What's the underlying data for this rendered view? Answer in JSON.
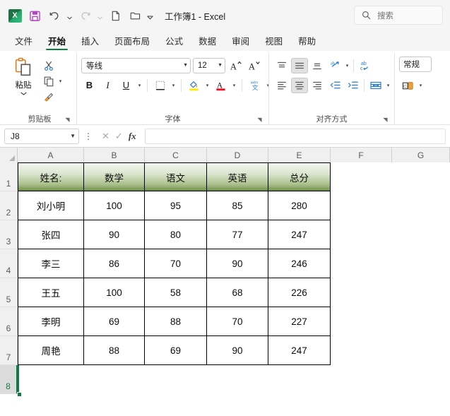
{
  "titlebar": {
    "document_title": "工作簿1  -  Excel",
    "app_logo": "excel-logo",
    "quick_access": [
      {
        "name": "save-icon",
        "glyph": "💾"
      },
      {
        "name": "undo-icon",
        "glyph": "↶"
      },
      {
        "name": "redo-icon",
        "glyph": "↷"
      },
      {
        "name": "new-file-icon",
        "glyph": "🗋"
      },
      {
        "name": "open-folder-icon",
        "glyph": "🗁"
      },
      {
        "name": "customize-qat-icon",
        "glyph": "ˇ"
      }
    ],
    "search": {
      "placeholder": "搜索",
      "icon": "search-icon"
    }
  },
  "ribbon_tabs": [
    {
      "label": "文件",
      "active": false
    },
    {
      "label": "开始",
      "active": true
    },
    {
      "label": "插入",
      "active": false
    },
    {
      "label": "页面布局",
      "active": false
    },
    {
      "label": "公式",
      "active": false
    },
    {
      "label": "数据",
      "active": false
    },
    {
      "label": "审阅",
      "active": false
    },
    {
      "label": "视图",
      "active": false
    },
    {
      "label": "帮助",
      "active": false
    }
  ],
  "ribbon": {
    "clipboard": {
      "group_label": "剪贴板",
      "paste_label": "粘贴",
      "cut_label": "剪切",
      "copy_label": "复制",
      "format_painter_label": "格式刷"
    },
    "font": {
      "group_label": "字体",
      "font_name": "等线",
      "font_size": "12",
      "grow_font": "A",
      "shrink_font": "A",
      "bold": "B",
      "italic": "I",
      "underline": "U",
      "borders": "borders-icon",
      "fill_color": "fill-color-icon",
      "font_color": "font-color-icon",
      "phonetic": "拼音"
    },
    "alignment": {
      "group_label": "对齐方式",
      "align_top": "top-align-icon",
      "align_middle": "middle-align-icon",
      "align_bottom": "bottom-align-icon",
      "orientation": "orientation-icon",
      "align_left": "align-left-icon",
      "align_center": "align-center-icon",
      "align_right": "align-right-icon",
      "decrease_indent": "decrease-indent-icon",
      "increase_indent": "increase-indent-icon",
      "wrap_text": "wrap-text-icon",
      "merge_center": "merge-center-icon"
    },
    "number": {
      "format_value": "常规",
      "accounting_icon": "accounting-format-icon"
    }
  },
  "formula_bar": {
    "name_box_value": "J8",
    "cancel_icon": "cancel-icon",
    "confirm_icon": "confirm-icon",
    "function_icon": "fx",
    "formula_value": ""
  },
  "sheet": {
    "column_headers": [
      "A",
      "B",
      "C",
      "D",
      "E",
      "F",
      "G"
    ],
    "row_headers": [
      "1",
      "2",
      "3",
      "4",
      "5",
      "6",
      "7",
      "8"
    ],
    "selected_cell": "A8",
    "table": {
      "header_row": [
        "姓名:",
        "数学",
        "语文",
        "英语",
        "总分"
      ],
      "rows": [
        [
          "刘小明",
          "100",
          "95",
          "85",
          "280"
        ],
        [
          "张四",
          "90",
          "80",
          "77",
          "247"
        ],
        [
          "李三",
          "86",
          "70",
          "90",
          "246"
        ],
        [
          "王五",
          "100",
          "58",
          "68",
          "226"
        ],
        [
          "李明",
          "69",
          "88",
          "70",
          "227"
        ],
        [
          "周艳",
          "88",
          "69",
          "90",
          "247"
        ]
      ]
    }
  },
  "colors": {
    "accent_green": "#107c41",
    "header_fill_dark": "#6f8f4b",
    "header_fill_light": "#f2f6ee"
  }
}
